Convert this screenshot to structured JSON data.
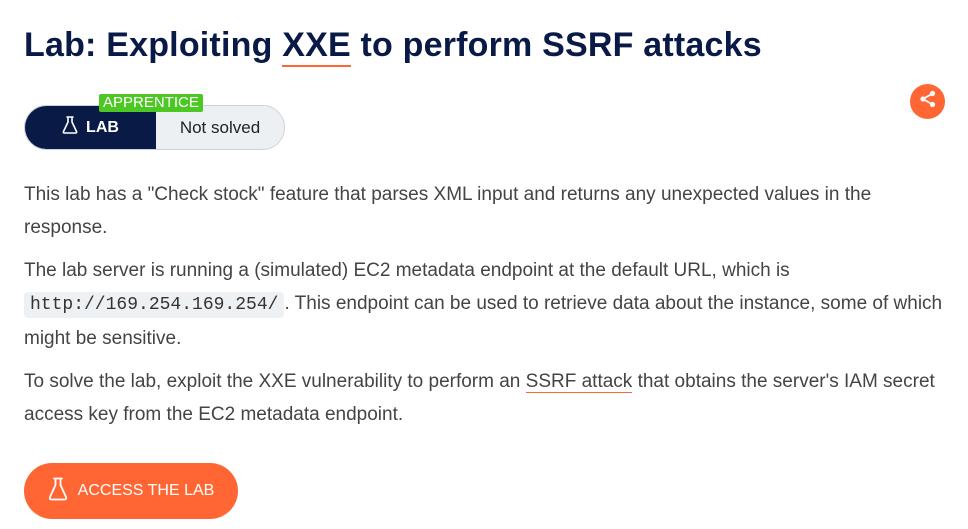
{
  "page": {
    "title_prefix": "Lab: Exploiting ",
    "title_link": "XXE",
    "title_suffix": " to perform SSRF attacks"
  },
  "badge": {
    "level": "APPRENTICE",
    "lab_label": "LAB",
    "status": "Not solved"
  },
  "share": {
    "icon": "share-icon"
  },
  "description": {
    "p1": "This lab has a \"Check stock\" feature that parses XML input and returns any unexpected values in the response.",
    "p2_before": "The lab server is running a (simulated) EC2 metadata endpoint at the default URL, which is ",
    "p2_code": "http://169.254.169.254/",
    "p2_after": ". This endpoint can be used to retrieve data about the instance, some of which might be sensitive.",
    "p3_before": "To solve the lab, exploit the XXE vulnerability to perform an ",
    "p3_link": "SSRF attack",
    "p3_after": " that obtains the server's IAM secret access key from the EC2 metadata endpoint."
  },
  "access_button": {
    "label": "ACCESS THE LAB",
    "icon": "flask-icon"
  },
  "colors": {
    "navy": "#0a1a47",
    "orange": "#ff6633",
    "green": "#4cc724",
    "status_bg": "#ecf0f3"
  }
}
